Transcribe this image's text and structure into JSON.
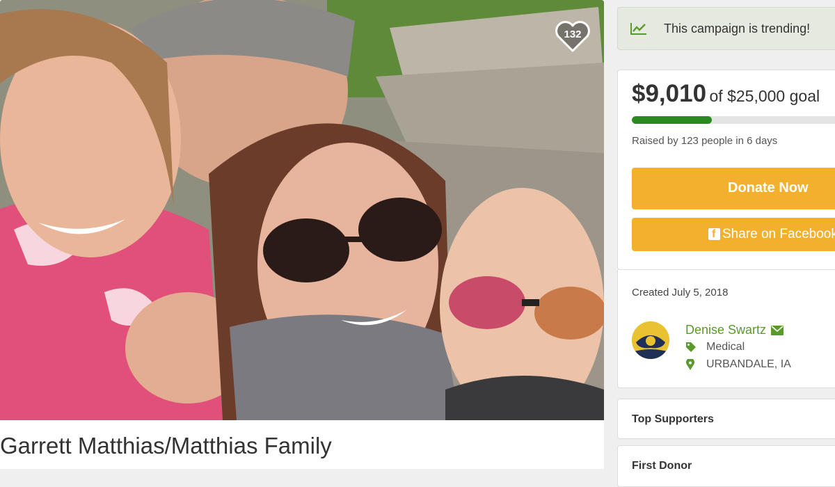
{
  "photo": {
    "heart_count": "132"
  },
  "campaign": {
    "title": "Garrett Matthias/Matthias Family"
  },
  "trending": {
    "text": "This campaign is trending!"
  },
  "progress": {
    "raised": "$9,010",
    "goal_text": "of $25,000 goal",
    "fraction": 0.36,
    "raised_by": "Raised by 123 people in 6 days"
  },
  "actions": {
    "donate": "Donate Now",
    "share": "Share on Facebook"
  },
  "creator": {
    "created": "Created July 5, 2018",
    "name": "Denise Swartz",
    "category": "Medical",
    "location": "URBANDALE, IA"
  },
  "sections": {
    "top_supporters": "Top Supporters",
    "first_donor": "First Donor"
  },
  "colors": {
    "accent_green": "#5a9a2c",
    "progress_green": "#2a8a1f",
    "button_orange": "#f3b02c"
  }
}
